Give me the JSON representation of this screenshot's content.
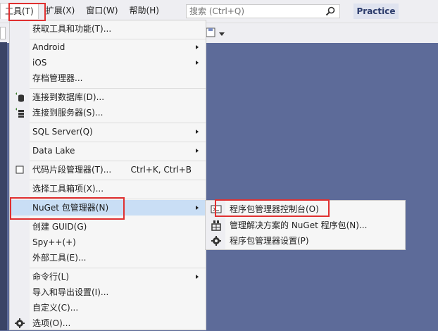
{
  "menubar": {
    "items": [
      {
        "label": "工具(T)"
      },
      {
        "label": "扩展(X)"
      },
      {
        "label": "窗口(W)"
      },
      {
        "label": "帮助(H)"
      }
    ]
  },
  "search": {
    "placeholder": "搜索 (Ctrl+Q)"
  },
  "practice_label": "Practice",
  "tools_menu": {
    "items": [
      {
        "label": "获取工具和功能(T)..."
      },
      {
        "label": "Android"
      },
      {
        "label": "iOS"
      },
      {
        "label": "存档管理器..."
      },
      {
        "label": "连接到数据库(D)..."
      },
      {
        "label": "连接到服务器(S)..."
      },
      {
        "label": "SQL Server(Q)"
      },
      {
        "label": "Data Lake"
      },
      {
        "label": "代码片段管理器(T)...",
        "shortcut": "Ctrl+K, Ctrl+B"
      },
      {
        "label": "选择工具箱项(X)..."
      },
      {
        "label": "NuGet 包管理器(N)"
      },
      {
        "label": "创建 GUID(G)"
      },
      {
        "label": "Spy++(+)"
      },
      {
        "label": "外部工具(E)..."
      },
      {
        "label": "命令行(L)"
      },
      {
        "label": "导入和导出设置(I)..."
      },
      {
        "label": "自定义(C)..."
      },
      {
        "label": "选项(O)..."
      }
    ]
  },
  "nuget_submenu": {
    "items": [
      {
        "label": "程序包管理器控制台(O)"
      },
      {
        "label": "管理解决方案的 NuGet 程序包(N)..."
      },
      {
        "label": "程序包管理器设置(P)"
      }
    ]
  },
  "colors": {
    "accent_highlight": "#c9def5",
    "annotation_red": "#e03030",
    "background": "#5d6b99"
  }
}
